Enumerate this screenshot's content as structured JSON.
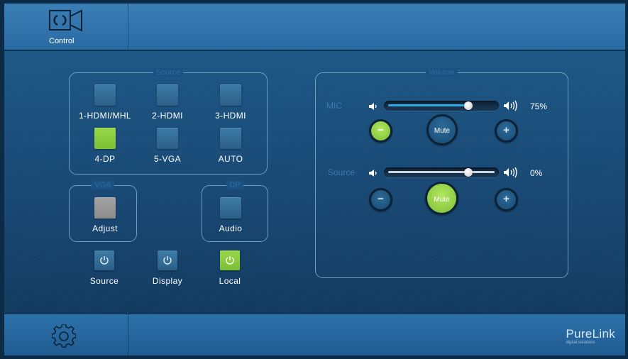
{
  "header": {
    "control_label": "Control"
  },
  "source_group": {
    "title": "Source",
    "buttons": [
      {
        "label": "1-HDMI/MHL",
        "active": false
      },
      {
        "label": "2-HDMI",
        "active": false
      },
      {
        "label": "3-HDMI",
        "active": false
      },
      {
        "label": "4-DP",
        "active": true
      },
      {
        "label": "5-VGA",
        "active": false
      },
      {
        "label": "AUTO",
        "active": false
      }
    ]
  },
  "vga_group": {
    "title": "VGA",
    "button_label": "Adjust"
  },
  "dp_group": {
    "title": "DP",
    "button_label": "Audio"
  },
  "power": [
    {
      "label": "Source",
      "active": false
    },
    {
      "label": "Display",
      "active": false
    },
    {
      "label": "Local",
      "active": true
    }
  ],
  "volume": {
    "title": "Volume",
    "channels": [
      {
        "label": "MIC",
        "level": 0.75,
        "percent_text": "75%",
        "mute_label": "Mute",
        "muted": false,
        "minus_highlight": true
      },
      {
        "label": "Source",
        "level": 0.75,
        "percent_text": "0%",
        "mute_label": "Mute",
        "muted": true,
        "minus_highlight": false
      }
    ]
  },
  "footer": {
    "brand": "PureLink",
    "tagline": "digital solutions"
  },
  "colors": {
    "active_green": "#8bcb3e",
    "button_blue": "#346c95",
    "accent_blue": "#2fa9e0"
  }
}
